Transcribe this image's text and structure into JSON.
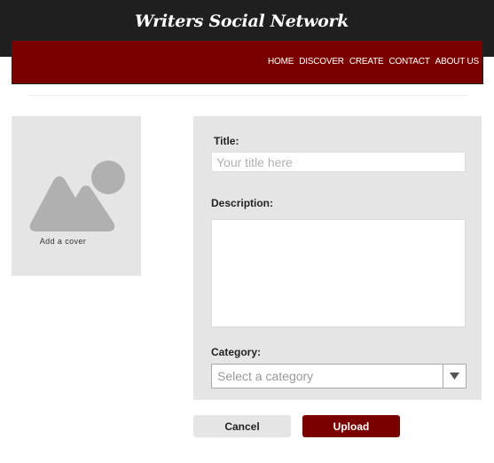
{
  "header": {
    "site_title": "Writers Social Network",
    "nav": [
      "HOME",
      "DISCOVER",
      "CREATE",
      "CONTACT",
      "ABOUT US"
    ]
  },
  "cover": {
    "label": "Add a cover",
    "icon": "image-placeholder-icon"
  },
  "form": {
    "title_label": "Title:",
    "title_placeholder": "Your title here",
    "title_value": "",
    "description_label": "Description:",
    "description_value": "",
    "category_label": "Category:",
    "category_placeholder": "Select a category"
  },
  "actions": {
    "cancel_label": "Cancel",
    "upload_label": "Upload"
  },
  "colors": {
    "brand": "#7a0000",
    "topbar": "#1f1f1f",
    "panel": "#e5e5e5"
  }
}
